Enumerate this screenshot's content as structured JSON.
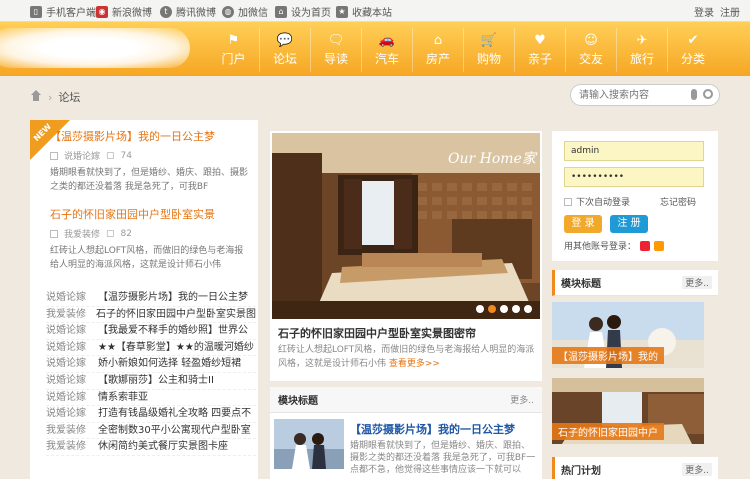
{
  "topbar": {
    "items": [
      {
        "icon": "phone-icon",
        "label": "手机客户端"
      },
      {
        "icon": "weibo-icon",
        "label": "新浪微博"
      },
      {
        "icon": "tencent-weibo-icon",
        "label": "腾讯微博"
      },
      {
        "icon": "wechat-icon",
        "label": "加微信"
      },
      {
        "icon": "home-icon",
        "label": "设为首页"
      },
      {
        "icon": "star-icon",
        "label": "收藏本站"
      }
    ],
    "login": "登录",
    "register": "注册"
  },
  "nav": [
    {
      "icon": "flag-icon",
      "glyph": "⚑",
      "label": "门户"
    },
    {
      "icon": "chat-icon",
      "glyph": "💬",
      "label": "论坛"
    },
    {
      "icon": "speech-icon",
      "glyph": "🗨",
      "label": "导读"
    },
    {
      "icon": "car-icon",
      "glyph": "🚗",
      "label": "汽车"
    },
    {
      "icon": "house-icon",
      "glyph": "⌂",
      "label": "房产"
    },
    {
      "icon": "cart-icon",
      "glyph": "🛒",
      "label": "购物"
    },
    {
      "icon": "heart-icon",
      "glyph": "♥",
      "label": "亲子"
    },
    {
      "icon": "smile-icon",
      "glyph": "☺",
      "label": "交友"
    },
    {
      "icon": "plane-icon",
      "glyph": "✈",
      "label": "旅行"
    },
    {
      "icon": "check-icon",
      "glyph": "✔",
      "label": "分类"
    }
  ],
  "breadcrumb": {
    "current": "论坛"
  },
  "search": {
    "placeholder": "请输入搜索内容"
  },
  "ribbon": "NEW",
  "featured": [
    {
      "title": "【温莎摄影片场】我的一日公主梦",
      "category": "说婚论嫁",
      "count": "74",
      "desc": "婚期眼看就快到了，但是婚纱、婚庆、跟拍、摄影之类的都还没着落 我是急死了，可我BF"
    },
    {
      "title": "石子的怀旧家田园中户型卧室实景",
      "category": "我爱装修",
      "count": "82",
      "desc": "红砖让人想起LOFT风格，而做旧的绿色与老海报给人明显的海派风格，这就是设计师石小伟"
    }
  ],
  "list": [
    {
      "category": "说婚论嫁",
      "title": "【温莎摄影片场】我的一日公主梦"
    },
    {
      "category": "我爱装修",
      "title": "石子的怀旧家田园中户型卧室实景图"
    },
    {
      "category": "说婚论嫁",
      "title": "【我最爱不释手的婚纱照】世界公"
    },
    {
      "category": "说婚论嫁",
      "title": "★★【春草影堂】★★的温暖河婚纱"
    },
    {
      "category": "说婚论嫁",
      "title": "娇小新娘如何选择 轻盈婚纱短裙"
    },
    {
      "category": "说婚论嫁",
      "title": "【歌娜丽莎】公主和骑士II"
    },
    {
      "category": "说婚论嫁",
      "title": "情系索菲亚"
    },
    {
      "category": "说婚论嫁",
      "title": "打造有钱晶级婚礼全攻略 四要点不"
    },
    {
      "category": "我爱装修",
      "title": "全密制数30平小公寓现代户型卧室"
    },
    {
      "category": "我爱装修",
      "title": "休闲简约美式餐厅实景图卡座"
    }
  ],
  "slider": {
    "watermark": "Our Home家",
    "title": "石子的怀旧家田园中户型卧室实景图密帘",
    "desc": "红砖让人想起LOFT风格，而做旧的绿色与老海报给人明显的海派风格，这就是设计师石小伟",
    "more": "查看更多>>",
    "slide_count": 5,
    "active_slide": 1
  },
  "center_block": {
    "title": "模块标题",
    "more": "更多..",
    "article_title": "【温莎摄影片场】我的一日公主梦",
    "article_desc": "婚期眼看就快到了，但是婚纱、婚庆、跟拍、摄影之类的都还没着落 我是急死了，可我BF一点都不急，他觉得这些事情应该一下就可以"
  },
  "login": {
    "username": "admin",
    "password": "••••••••••",
    "remember": "下次自动登录",
    "forgot": "忘记密码",
    "login_btn": "登 录",
    "register_btn": "注 册",
    "other": "用其他账号登录："
  },
  "right_blocks": [
    {
      "title": "模块标题",
      "more": "更多..",
      "caption": "【温莎摄影片场】我的"
    },
    {
      "caption": "石子的怀旧家田园中户"
    },
    {
      "title": "热门计划",
      "more": "更多.."
    }
  ],
  "colors": {
    "accent": "#f08a1e",
    "header": "#f6a623",
    "link": "#1f56a6"
  }
}
